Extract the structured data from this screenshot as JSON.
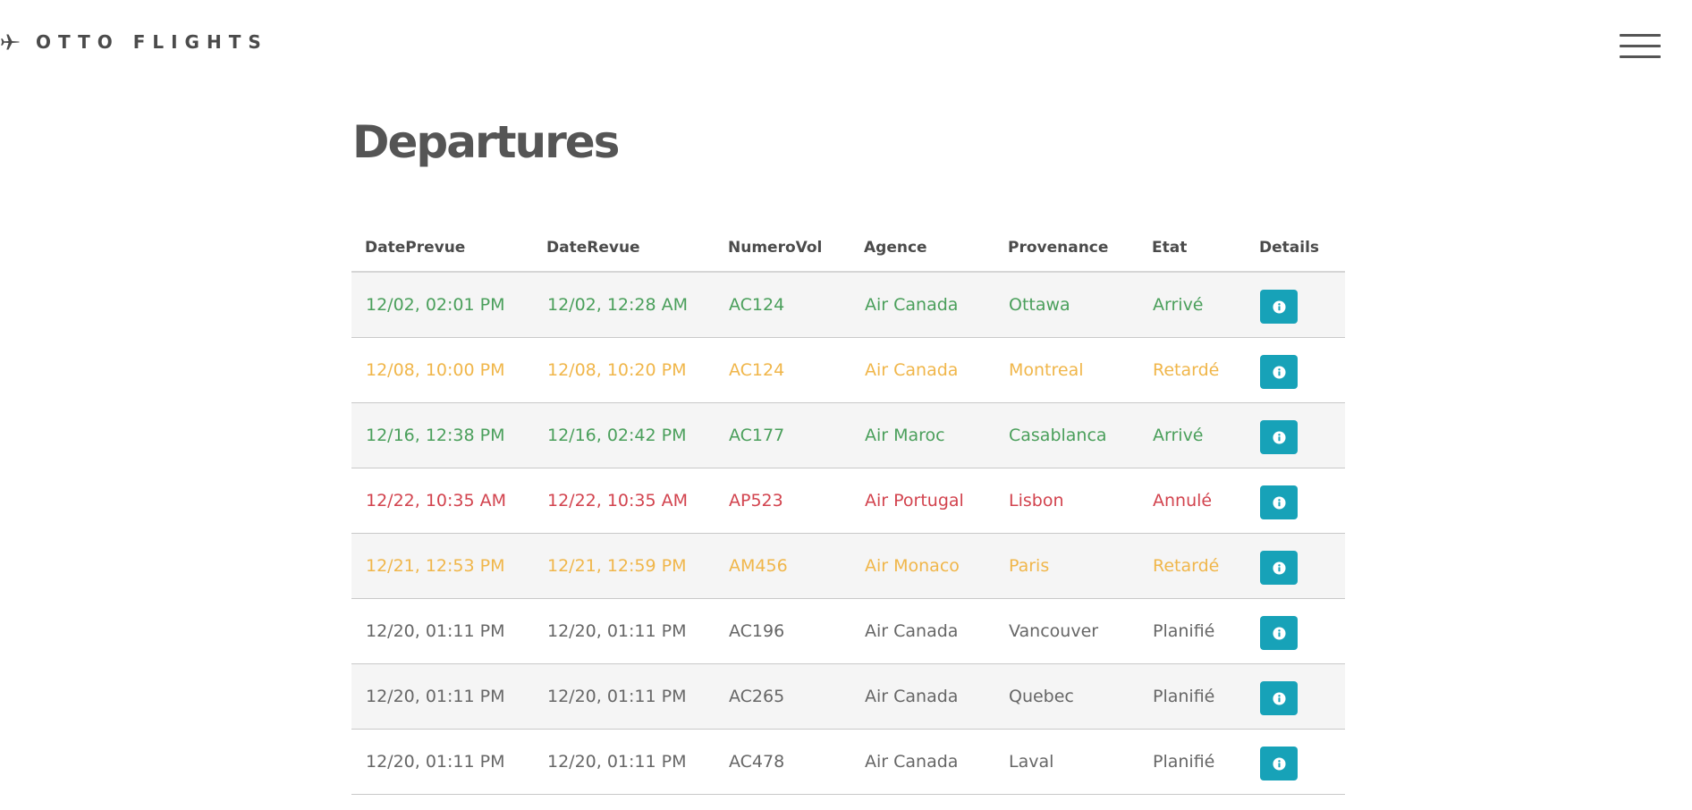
{
  "header": {
    "brand_text": "OTTO FLIGHTS",
    "brand_icon": "airplane-icon",
    "menu_icon": "hamburger-menu-icon"
  },
  "page": {
    "title": "Departures"
  },
  "colors": {
    "arrived": "#4a9f5b",
    "delayed": "#f0b64a",
    "cancelled": "#d2434e",
    "planned": "#666666",
    "details_button": "#17a2b8"
  },
  "table": {
    "columns": [
      "DatePrevue",
      "DateRevue",
      "NumeroVol",
      "Agence",
      "Provenance",
      "Etat",
      "Details"
    ],
    "rows": [
      {
        "date_prevue": "12/02, 02:01 PM",
        "date_revue": "12/02, 12:28 AM",
        "numero_vol": "AC124",
        "agence": "Air Canada",
        "provenance": "Ottawa",
        "etat": "Arrivé",
        "status_color": "#4a9f5b"
      },
      {
        "date_prevue": "12/08, 10:00 PM",
        "date_revue": "12/08, 10:20 PM",
        "numero_vol": "AC124",
        "agence": "Air Canada",
        "provenance": "Montreal",
        "etat": "Retardé",
        "status_color": "#f0b64a"
      },
      {
        "date_prevue": "12/16, 12:38 PM",
        "date_revue": "12/16, 02:42 PM",
        "numero_vol": "AC177",
        "agence": "Air Maroc",
        "provenance": "Casablanca",
        "etat": "Arrivé",
        "status_color": "#4a9f5b"
      },
      {
        "date_prevue": "12/22, 10:35 AM",
        "date_revue": "12/22, 10:35 AM",
        "numero_vol": "AP523",
        "agence": "Air Portugal",
        "provenance": "Lisbon",
        "etat": "Annulé",
        "status_color": "#d2434e"
      },
      {
        "date_prevue": "12/21, 12:53 PM",
        "date_revue": "12/21, 12:59 PM",
        "numero_vol": "AM456",
        "agence": "Air Monaco",
        "provenance": "Paris",
        "etat": "Retardé",
        "status_color": "#f0b64a"
      },
      {
        "date_prevue": "12/20, 01:11 PM",
        "date_revue": "12/20, 01:11 PM",
        "numero_vol": "AC196",
        "agence": "Air Canada",
        "provenance": "Vancouver",
        "etat": "Planifié",
        "status_color": "#666666"
      },
      {
        "date_prevue": "12/20, 01:11 PM",
        "date_revue": "12/20, 01:11 PM",
        "numero_vol": "AC265",
        "agence": "Air Canada",
        "provenance": "Quebec",
        "etat": "Planifié",
        "status_color": "#666666"
      },
      {
        "date_prevue": "12/20, 01:11 PM",
        "date_revue": "12/20, 01:11 PM",
        "numero_vol": "AC478",
        "agence": "Air Canada",
        "provenance": "Laval",
        "etat": "Planifié",
        "status_color": "#666666"
      }
    ]
  }
}
